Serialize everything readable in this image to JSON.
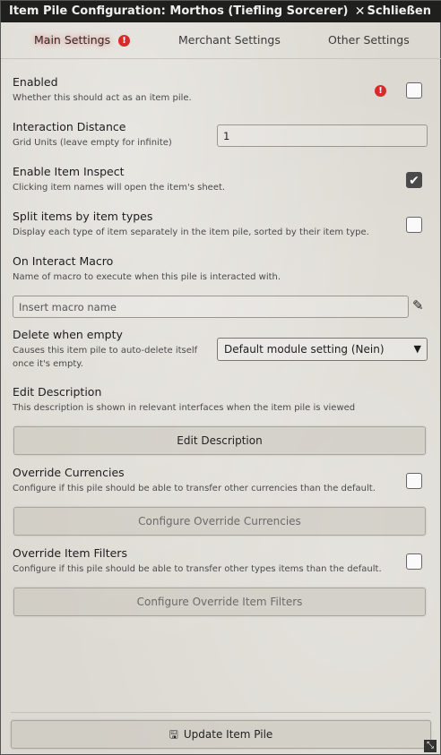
{
  "window": {
    "title": "Item Pile Configuration: Morthos (Tiefling Sorcerer)",
    "close_label": "Schließen"
  },
  "tabs": [
    {
      "label": "Main Settings",
      "active": true
    },
    {
      "label": "Merchant Settings",
      "active": false
    },
    {
      "label": "Other Settings",
      "active": false
    }
  ],
  "settings": {
    "enabled": {
      "label": "Enabled",
      "hint": "Whether this should act as an item pile.",
      "checked": false
    },
    "interaction_distance": {
      "label": "Interaction Distance",
      "hint": "Grid Units (leave empty for infinite)",
      "value": "1"
    },
    "enable_item_inspect": {
      "label": "Enable Item Inspect",
      "hint": "Clicking item names will open the item's sheet.",
      "checked": true
    },
    "split_items": {
      "label": "Split items by item types",
      "hint": "Display each type of item separately in the item pile, sorted by their item type.",
      "checked": false
    },
    "on_interact_macro": {
      "label": "On Interact Macro",
      "hint": "Name of macro to execute when this pile is interacted with.",
      "placeholder": "Insert macro name"
    },
    "delete_when_empty": {
      "label": "Delete when empty",
      "hint_line1": "Causes this item pile to auto-delete itself",
      "hint_line2": "once it's empty.",
      "selected": "Default module setting (Nein)"
    },
    "edit_description": {
      "label": "Edit Description",
      "hint": "This description is shown in relevant interfaces when the item pile is viewed",
      "button": "Edit Description"
    },
    "override_currencies": {
      "label": "Override Currencies",
      "hint": "Configure if this pile should be able to transfer other currencies than the default.",
      "checked": false,
      "button": "Configure Override Currencies"
    },
    "override_item_filters": {
      "label": "Override Item Filters",
      "hint": "Configure if this pile should be able to transfer other types items than the default.",
      "checked": false,
      "button": "Configure Override Item Filters"
    }
  },
  "footer": {
    "update_button": "Update Item Pile"
  }
}
